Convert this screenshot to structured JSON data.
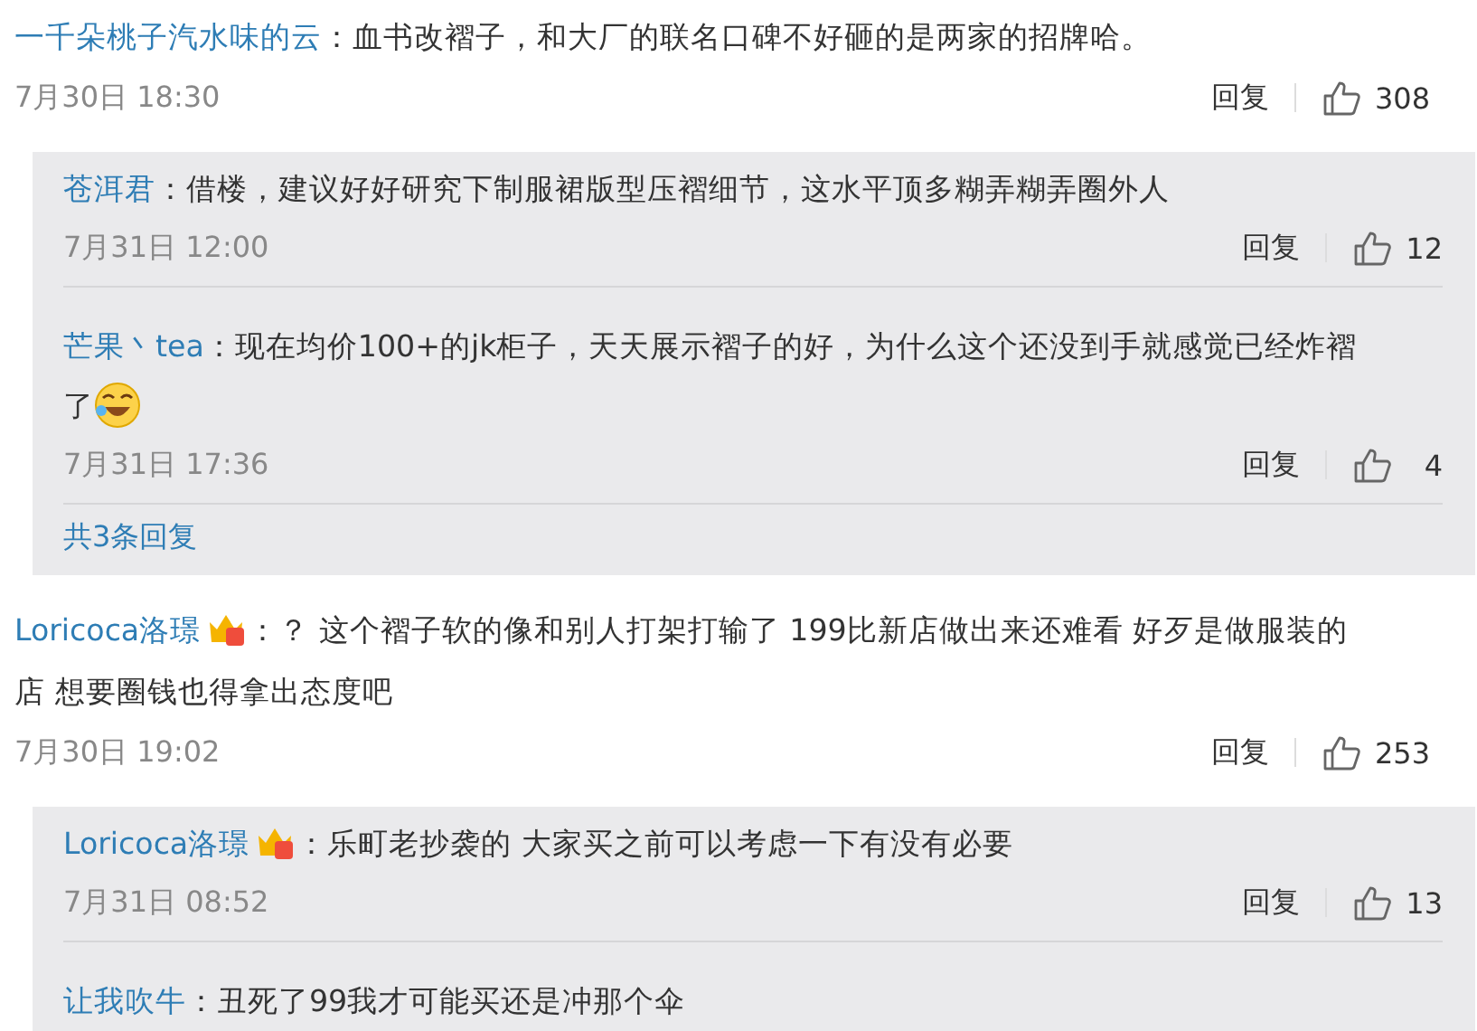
{
  "comments": [
    {
      "author": "一千朵桃子汽水味的云",
      "badge": false,
      "text": "：血书改褶子，和大厂的联名口碑不好砸的是两家的招牌哈。",
      "emoji": false,
      "time": "7月30日 18:30",
      "reply_label": "回复",
      "likes": "308",
      "replies": [
        {
          "author": "苍洱君",
          "badge": false,
          "text": "：借楼，建议好好研究下制服裙版型压褶细节，这水平顶多糊弄糊弄圈外人",
          "emoji": false,
          "time": "7月31日 12:00",
          "reply_label": "回复",
          "likes": "12"
        },
        {
          "author": "芒果丶tea",
          "badge": false,
          "text": "：现在均价100+的jk柜子，天天展示褶子的好，为什么这个还没到手就感觉已经炸褶了",
          "emoji": true,
          "time": "7月31日 17:36",
          "reply_label": "回复",
          "likes": "4"
        }
      ],
      "more_replies": "共3条回复"
    },
    {
      "author": "Loricoca洛璟",
      "badge": true,
      "text": "：？ 这个褶子软的像和别人打架打输了 199比新店做出来还难看 好歹是做服装的店 想要圈钱也得拿出态度吧",
      "emoji": false,
      "time": "7月30日 19:02",
      "reply_label": "回复",
      "likes": "253",
      "replies": [
        {
          "author": "Loricoca洛璟",
          "badge": true,
          "text": "：乐町老抄袭的 大家买之前可以考虑一下有没有必要",
          "emoji": false,
          "time": "7月31日 08:52",
          "reply_label": "回复",
          "likes": "13"
        },
        {
          "author": "让我吹牛",
          "badge": false,
          "text": "：丑死了99我才可能买还是冲那个伞",
          "emoji": false
        }
      ]
    }
  ]
}
